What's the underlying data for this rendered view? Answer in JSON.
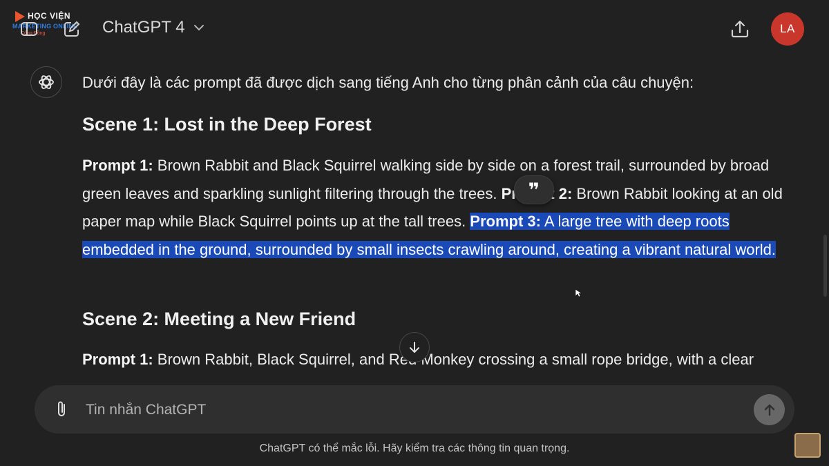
{
  "logo": {
    "top": "HỌC VIỆN",
    "middle": "MARKETING ONLINE",
    "bottom": "Cộng Đồng"
  },
  "header": {
    "model_name": "ChatGPT 4",
    "user_initials": "LA"
  },
  "message": {
    "intro": "Dưới đây là các prompt đã được dịch sang tiếng Anh cho từng phân cảnh của câu chuyện:",
    "scene1": {
      "title": "Scene 1: Lost in the Deep Forest",
      "p1_label": "Prompt 1:",
      "p1_text": " Brown Rabbit and Black Squirrel walking side by side on a forest trail, surrounded by broad green leaves and sparkling sunlight filtering through the trees. ",
      "p2_label": "Prompt 2:",
      "p2_text": " Brown Rabbit looking at an old paper map while Black Squirrel points up at the tall trees. ",
      "p3_label": "Prompt 3:",
      "p3_text": " A large tree with deep roots embedded in the ground, surrounded by small insects crawling around, creating a vibrant natural world."
    },
    "scene2": {
      "title": "Scene 2: Meeting a New Friend",
      "p1_label": "Prompt 1:",
      "p1_text": " Brown Rabbit, Black Squirrel, and Red Monkey crossing a small rope bridge, with a clear"
    }
  },
  "quote_button": {
    "glyph": "❞"
  },
  "composer": {
    "placeholder": "Tin nhắn ChatGPT"
  },
  "disclaimer": "ChatGPT có thể mắc lỗi. Hãy kiểm tra các thông tin quan trọng.",
  "icons": [
    "sidebar-icon",
    "new-chat-icon",
    "chevron-down-icon",
    "share-icon",
    "openai-logo-icon",
    "quote-icon",
    "arrow-down-icon",
    "paperclip-icon",
    "arrow-up-icon"
  ],
  "colors": {
    "background": "#212121",
    "selection": "#1a49b8",
    "avatar": "#c9372c",
    "composer": "#2f2f2f"
  }
}
